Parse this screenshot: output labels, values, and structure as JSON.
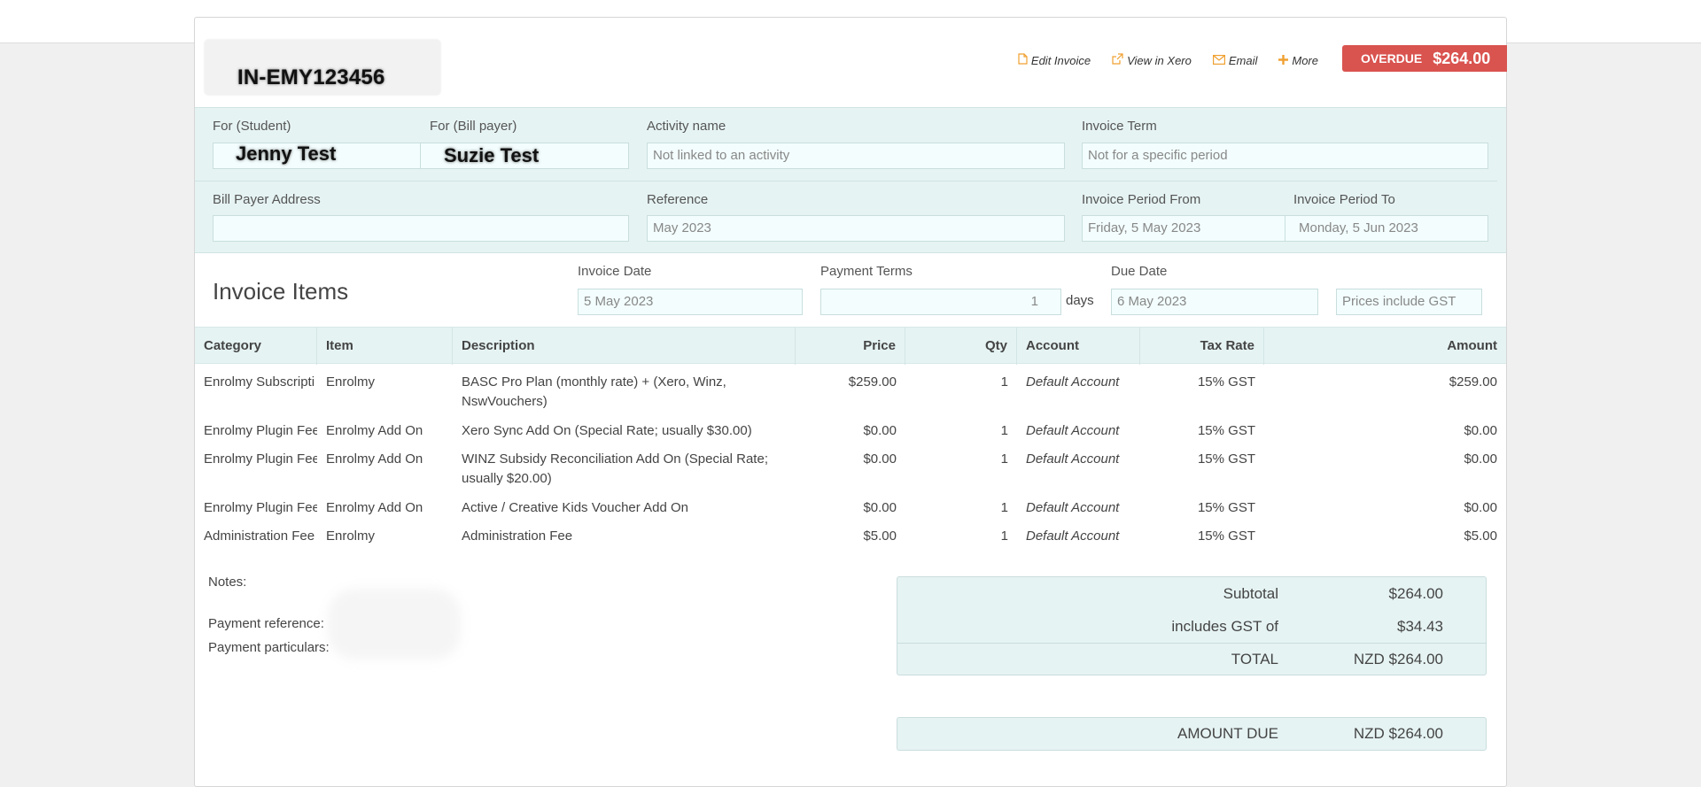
{
  "header": {
    "invoice_number": "IN-EMY123456",
    "actions": [
      {
        "icon": "file-icon",
        "label": "Edit Invoice"
      },
      {
        "icon": "external-link-icon",
        "label": "View in Xero"
      },
      {
        "icon": "envelope-icon",
        "label": "Email"
      },
      {
        "icon": "plus-icon",
        "label": "More"
      }
    ],
    "status_label": "OVERDUE",
    "status_amount": "$264.00",
    "status_color": "#d9534f"
  },
  "info": {
    "student_label": "For (Student)",
    "student_value": "Jenny Test",
    "billpayer_label": "For (Bill payer)",
    "billpayer_value": "Suzie Test",
    "activity_label": "Activity name",
    "activity_value": "Not linked to an activity",
    "term_label": "Invoice Term",
    "term_value": "Not for a specific period",
    "address_label": "Bill Payer Address",
    "address_value": "",
    "reference_label": "Reference",
    "reference_value": "May 2023",
    "period_from_label": "Invoice Period From",
    "period_from_value": "Friday, 5 May 2023",
    "period_to_label": "Invoice Period To",
    "period_to_value": "Monday, 5 Jun 2023"
  },
  "items_header": {
    "title": "Invoice Items",
    "invoice_date_label": "Invoice Date",
    "invoice_date_value": "5 May 2023",
    "payment_terms_label": "Payment Terms",
    "payment_terms_value": "1",
    "payment_terms_unit": "days",
    "due_date_label": "Due Date",
    "due_date_value": "6 May 2023",
    "gst_mode": "Prices include GST"
  },
  "table": {
    "columns": [
      "Category",
      "Item",
      "Description",
      "Price",
      "Qty",
      "Account",
      "Tax Rate",
      "Amount"
    ],
    "rows": [
      {
        "category": "Enrolmy Subscripti",
        "item": "Enrolmy",
        "description": "BASC Pro Plan (monthly rate) + (Xero, Winz, NswVouchers)",
        "price": "$259.00",
        "qty": "1",
        "account": "Default Account",
        "tax": "15% GST",
        "amount": "$259.00"
      },
      {
        "category": "Enrolmy Plugin Fee",
        "item": "Enrolmy Add On",
        "description": "Xero Sync Add On (Special Rate; usually $30.00)",
        "price": "$0.00",
        "qty": "1",
        "account": "Default Account",
        "tax": "15% GST",
        "amount": "$0.00"
      },
      {
        "category": "Enrolmy Plugin Fee",
        "item": "Enrolmy Add On",
        "description": "WINZ Subsidy Reconciliation Add On (Special Rate; usually $20.00)",
        "price": "$0.00",
        "qty": "1",
        "account": "Default Account",
        "tax": "15% GST",
        "amount": "$0.00"
      },
      {
        "category": "Enrolmy Plugin Fee",
        "item": "Enrolmy Add On",
        "description": "Active / Creative Kids Voucher Add On",
        "price": "$0.00",
        "qty": "1",
        "account": "Default Account",
        "tax": "15% GST",
        "amount": "$0.00"
      },
      {
        "category": "Administration Fee",
        "item": "Enrolmy",
        "description": "Administration Fee",
        "price": "$5.00",
        "qty": "1",
        "account": "Default Account",
        "tax": "15% GST",
        "amount": "$5.00"
      }
    ]
  },
  "notes": {
    "notes_label": "Notes:",
    "payment_reference_label": "Payment reference:",
    "payment_particulars_label": "Payment particulars:"
  },
  "totals": {
    "subtotal_label": "Subtotal",
    "subtotal_value": "$264.00",
    "gst_label": "includes GST of",
    "gst_value": "$34.43",
    "total_label": "TOTAL",
    "total_value": "NZD $264.00",
    "amount_due_label": "AMOUNT DUE",
    "amount_due_value": "NZD $264.00"
  }
}
